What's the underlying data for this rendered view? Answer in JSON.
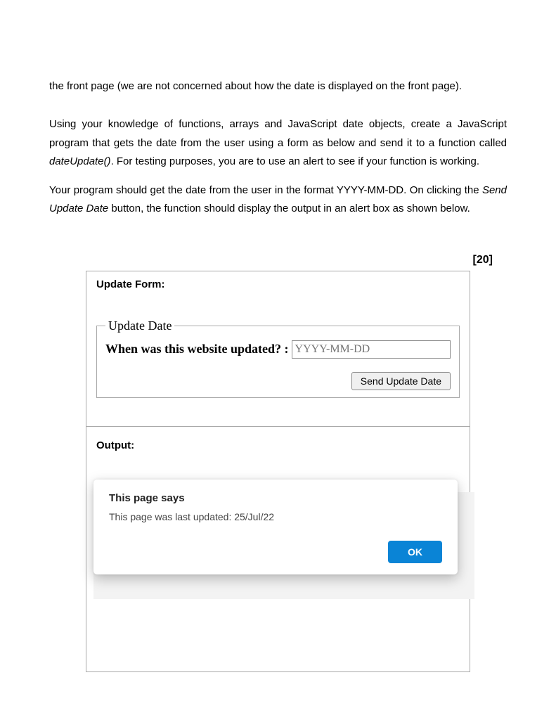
{
  "intro_line": "the front page (we are not concerned about how the date is displayed on the front page).",
  "para1_a": "Using your knowledge of functions, arrays and JavaScript date objects, create a JavaScript program that gets the date from the user using a form as below and send it to a function called ",
  "para1_func": "dateUpdate()",
  "para1_b": ". For testing purposes, you are to use an alert to see if your function is working.",
  "para2_a": "Your program should get the date from the user in the format YYYY-MM-DD. On clicking the ",
  "para2_btn": "Send Update Date",
  "para2_b": " button, the function should display the output in an alert box as shown below.",
  "marks": "[20]",
  "form": {
    "panel_title": "Update Form:",
    "legend": "Update Date",
    "prompt": "When was this website updated? :",
    "placeholder": "YYYY-MM-DD",
    "button": "Send Update Date"
  },
  "output": {
    "panel_title": "Output:",
    "alert_title": "This page says",
    "alert_message": "This page was last updated: 25/Jul/22",
    "ok": "OK"
  }
}
